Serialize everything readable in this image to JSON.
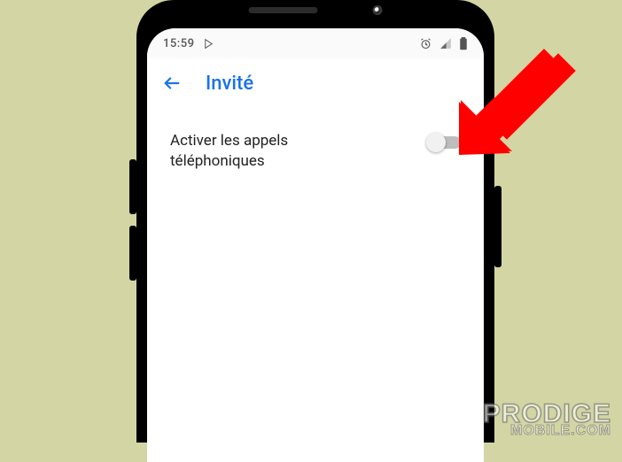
{
  "status_bar": {
    "time": "15:59"
  },
  "app_bar": {
    "title": "Invité"
  },
  "settings": {
    "enable_calls": {
      "label": "Activer les appels téléphoniques",
      "enabled": false
    }
  },
  "watermark": {
    "line1": "PRODIGE",
    "line2": "MOBILE.COM"
  }
}
